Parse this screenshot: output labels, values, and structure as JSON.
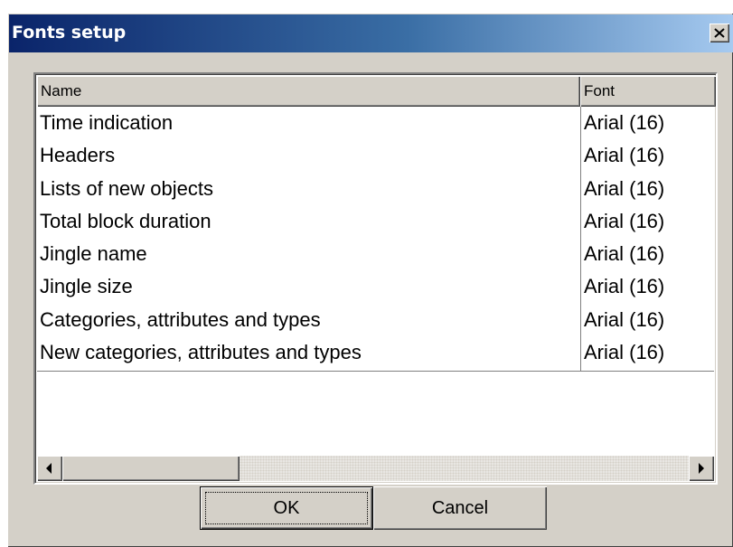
{
  "window": {
    "title": "Fonts setup",
    "close_glyph": "✕",
    "close_icon": "close-icon"
  },
  "list": {
    "columns": [
      "Name",
      "Font"
    ],
    "rows": [
      {
        "name": "Time indication",
        "font": "Arial (16)"
      },
      {
        "name": "Headers",
        "font": "Arial (16)"
      },
      {
        "name": "Lists of new objects",
        "font": "Arial (16)"
      },
      {
        "name": "Total block duration",
        "font": "Arial (16)"
      },
      {
        "name": "Jingle name",
        "font": "Arial (16)"
      },
      {
        "name": "Jingle size",
        "font": "Arial (16)"
      },
      {
        "name": "Categories, attributes and types",
        "font": "Arial (16)"
      },
      {
        "name": "New categories, attributes and types",
        "font": "Arial (16)"
      }
    ]
  },
  "buttons": {
    "ok": "OK",
    "cancel": "Cancel"
  },
  "colors": {
    "title_gradient_start": "#0a246a",
    "title_gradient_end": "#a6caf0",
    "dialog_face": "#d4d0c8"
  }
}
